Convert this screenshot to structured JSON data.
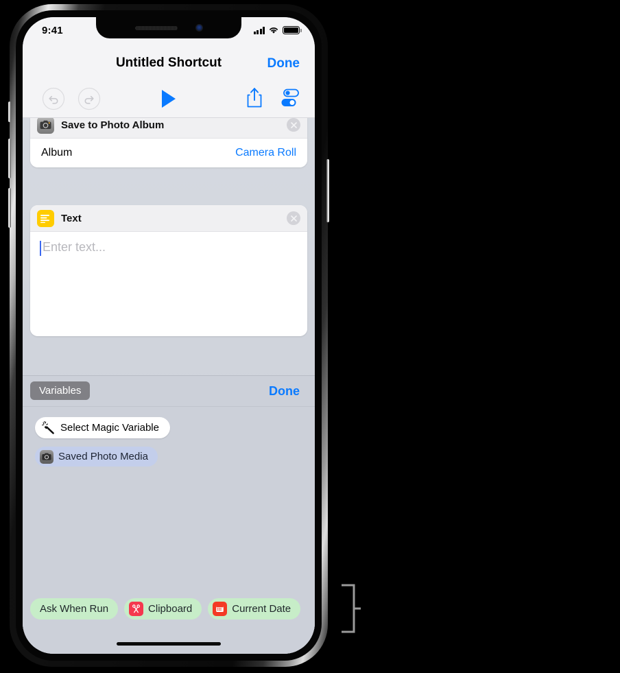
{
  "status_bar": {
    "time": "9:41",
    "icons": [
      "signal-bars-icon",
      "wifi-icon",
      "battery-icon"
    ]
  },
  "nav_bar": {
    "title": "Untitled Shortcut",
    "done_label": "Done"
  },
  "toolbar": {
    "undo_label": "undo-icon",
    "redo_label": "redo-icon",
    "play_label": "play-icon",
    "share_label": "share-icon",
    "settings_label": "settings-toggles-icon"
  },
  "actions": [
    {
      "title": "Save to Photo Album",
      "icon": "camera-icon",
      "icon_color": "#8d8d8d",
      "close_label": "×",
      "params": [
        {
          "label": "Album",
          "value": "Camera Roll"
        }
      ]
    },
    {
      "title": "Text",
      "icon": "text-lines-icon",
      "icon_color": "#ffcc00",
      "close_label": "×",
      "placeholder": "Enter text..."
    }
  ],
  "variables_panel": {
    "tab_label": "Variables",
    "done_label": "Done",
    "magic_variable": {
      "label": "Select Magic Variable",
      "icon": "magic-wand-icon"
    },
    "variables": [
      {
        "label": "Saved Photo Media",
        "icon": "camera-icon",
        "pill_color": "#c3ceeb"
      }
    ]
  },
  "suggestions": [
    {
      "label": "Ask When Run",
      "icon": null,
      "pill_color": "#c7edc8"
    },
    {
      "label": "Clipboard",
      "icon": "scissors-icon",
      "icon_color": "#f5384e",
      "pill_color": "#c7edc8"
    },
    {
      "label": "Current Date",
      "icon": "calendar-icon",
      "icon_color": "#f43a25",
      "pill_color": "#c7edc8"
    }
  ],
  "colors": {
    "accent_blue": "#0a7aff",
    "canvas": "#ccd0d9",
    "chrome": "#f4f4f6"
  }
}
